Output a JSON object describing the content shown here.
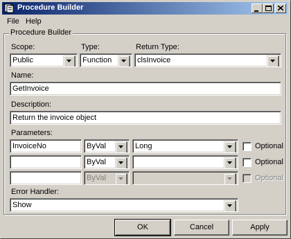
{
  "window": {
    "title": "Procedure Builder"
  },
  "menu": [
    {
      "label": "File"
    },
    {
      "label": "Help"
    }
  ],
  "group": {
    "label": "Procedure Builder"
  },
  "scope": {
    "label": "Scope:",
    "value": "Public"
  },
  "type": {
    "label": "Type:",
    "value": "Function"
  },
  "return_type": {
    "label": "Return Type:",
    "value": "clsInvoice"
  },
  "name": {
    "label": "Name:",
    "value": "GetInvoice"
  },
  "description": {
    "label": "Description:",
    "value": "Return the invoice object"
  },
  "parameters": {
    "label": "Parameters:",
    "optional_label": "Optional",
    "rows": [
      {
        "name": "InvoiceNo",
        "passing": "ByVal",
        "type": "Long",
        "optional": false,
        "enabled": true
      },
      {
        "name": "",
        "passing": "ByVal",
        "type": "",
        "optional": false,
        "enabled": true
      },
      {
        "name": "",
        "passing": "ByVal",
        "type": "",
        "optional": false,
        "enabled": false
      }
    ]
  },
  "error_handler": {
    "label": "Error Handler:",
    "value": "Show"
  },
  "buttons": {
    "ok": "OK",
    "cancel": "Cancel",
    "apply": "Apply"
  }
}
